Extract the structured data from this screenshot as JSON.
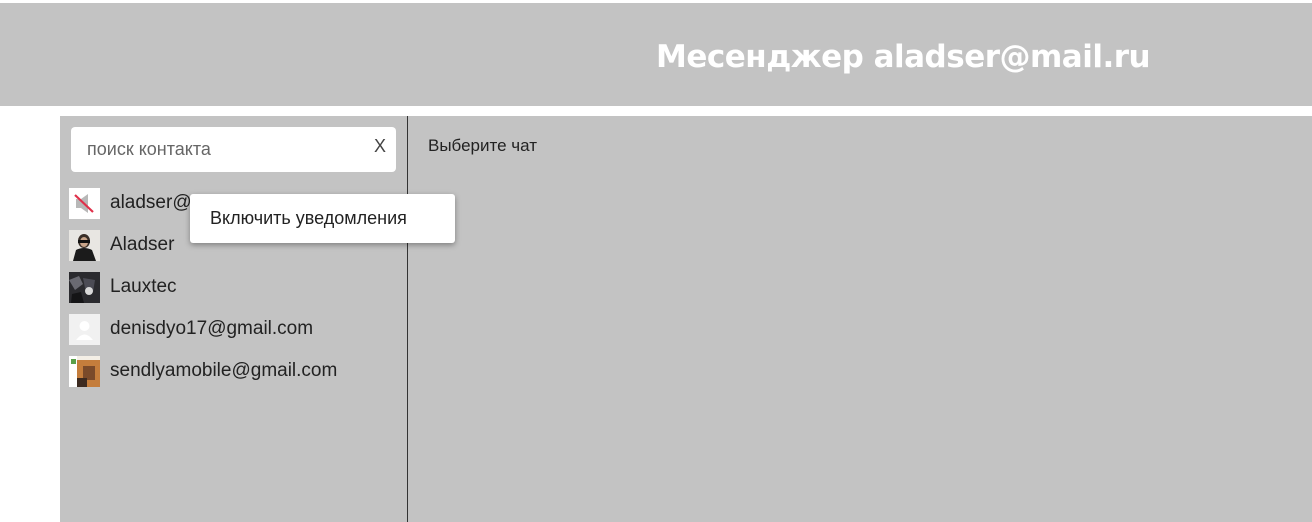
{
  "header": {
    "title": "Месенджер aladser@mail.ru"
  },
  "search": {
    "placeholder": "поиск контакта",
    "value": "",
    "clear_label": "X"
  },
  "contacts": [
    {
      "name": "aladser@mail.ru",
      "avatar": "muted-speaker-icon"
    },
    {
      "name": "Aladser",
      "avatar": "user-photo-avatar"
    },
    {
      "name": "Lauxtec",
      "avatar": "user-photo-avatar"
    },
    {
      "name": "denisdyo17@gmail.com",
      "avatar": "default-user-avatar"
    },
    {
      "name": "sendlyamobile@gmail.com",
      "avatar": "user-photo-avatar"
    }
  ],
  "context_menu": {
    "items": [
      {
        "label": "Включить уведомления"
      }
    ]
  },
  "chat": {
    "empty_text": "Выберите чат"
  },
  "colors": {
    "panel_bg": "#c3c3c3",
    "header_text": "#ffffff",
    "muted_icon": "#e0304a"
  }
}
